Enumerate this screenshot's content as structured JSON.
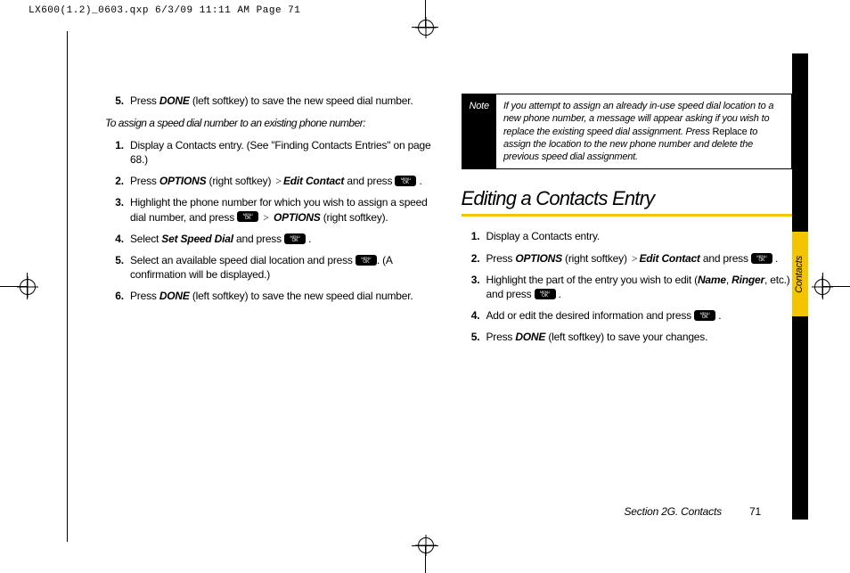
{
  "crop_header": "LX600(1.2)_0603.qxp  6/3/09  11:11 AM  Page 71",
  "left": {
    "step5": {
      "prefix": "Press ",
      "key": "DONE",
      "suffix": " (left softkey) to save the new speed dial number."
    },
    "intro": "To assign a speed dial number to an existing phone number:",
    "s1": "Display a Contacts entry. (See \"Finding Contacts Entries\" on page 68.)",
    "s2": {
      "a": "Press ",
      "b": "OPTIONS",
      "c": " (right softkey) ",
      "gt": ">",
      "d": "Edit Contact",
      "e": " and press "
    },
    "s3": {
      "a": "Highlight the phone number for which you wish to assign a speed dial number, and press ",
      "gt": ">",
      "b": "OPTIONS",
      "c": " (right softkey)."
    },
    "s4": {
      "a": "Select ",
      "b": "Set Speed Dial",
      "c": " and press "
    },
    "s5": {
      "a": "Select an available speed dial location and press ",
      "b": ". (A confirmation will be displayed.)"
    },
    "s6": {
      "a": "Press ",
      "b": "DONE",
      "c": " (left softkey) to save the new speed dial number."
    }
  },
  "note": {
    "label": "Note",
    "pre": "If you attempt to assign an already in-use speed dial location to a new phone number, a message will appear asking if you wish to replace the existing speed dial assignment. Press ",
    "bold": "Replace",
    "post": " to assign the location to the new phone number and delete the previous speed dial assignment."
  },
  "section_title": "Editing a Contacts Entry",
  "right": {
    "s1": "Display a Contacts entry.",
    "s2": {
      "a": "Press ",
      "b": "OPTIONS",
      "c": " (right softkey) ",
      "gt": ">",
      "d": "Edit Contact",
      "e": " and press "
    },
    "s3": {
      "a": "Highlight the part of the entry you wish to edit (",
      "b": "Name",
      "c": ", ",
      "d": "Ringer",
      "e": ", etc.) and press "
    },
    "s4": {
      "a": "Add or edit the desired information and press "
    },
    "s5": {
      "a": "Press ",
      "b": "DONE",
      "c": " (left softkey) to save your changes."
    }
  },
  "side_tab": "Contacts",
  "footer_section": "Section 2G. Contacts",
  "footer_page": "71"
}
